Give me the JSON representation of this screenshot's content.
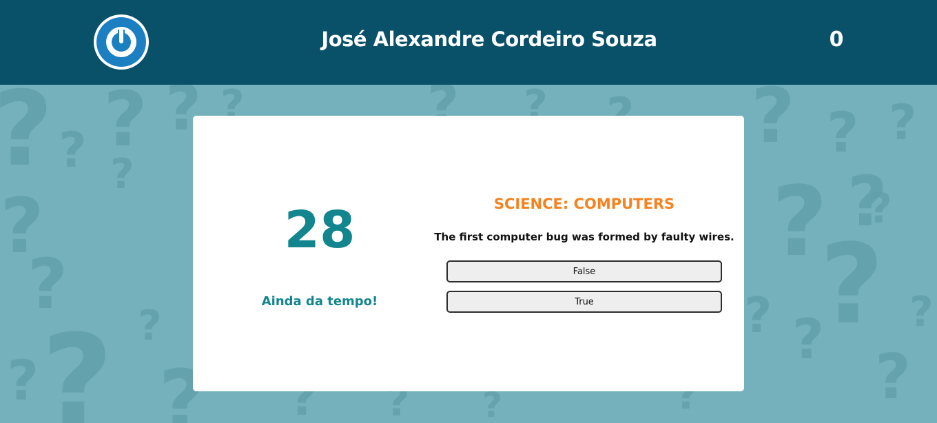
{
  "header": {
    "logo_icon": "power-icon",
    "player_name": "José Alexandre Cordeiro Souza",
    "score": "0"
  },
  "game": {
    "timer": "28",
    "timer_message": "Ainda da tempo!",
    "category": "SCIENCE: COMPUTERS",
    "question": "The first computer bug was formed by faulty wires.",
    "answers": [
      {
        "label": "False"
      },
      {
        "label": "True"
      }
    ]
  },
  "colors": {
    "header_bg": "#095069",
    "page_bg": "#75b1bd",
    "logo_blue": "#1c7fc2",
    "accent_teal": "#13858f",
    "category_orange": "#f5821f"
  }
}
